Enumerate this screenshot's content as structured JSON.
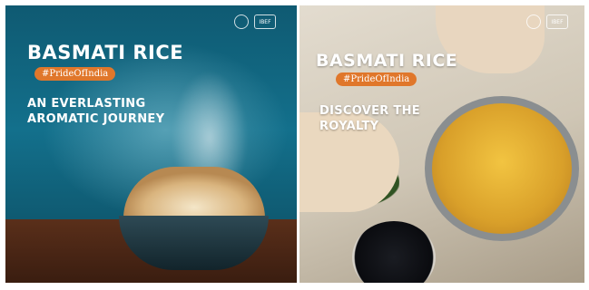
{
  "panels": [
    {
      "title": "BASMATI RICE",
      "hashtag": "#PrideOfIndia",
      "tagline_line1": "AN EVERLASTING",
      "tagline_line2": "AROMATIC JOURNEY",
      "logos": [
        "",
        "IBEF"
      ]
    },
    {
      "title": "BASMATI RICE",
      "hashtag": "#PrideOfIndia",
      "tagline_line1": "DISCOVER THE",
      "tagline_line2": "ROYALTY",
      "logos": [
        "",
        "IBEF"
      ]
    }
  ],
  "colors": {
    "left_background": "#12627a",
    "hashtag_badge": "#e0772b",
    "right_background": "#d6cdbd"
  }
}
